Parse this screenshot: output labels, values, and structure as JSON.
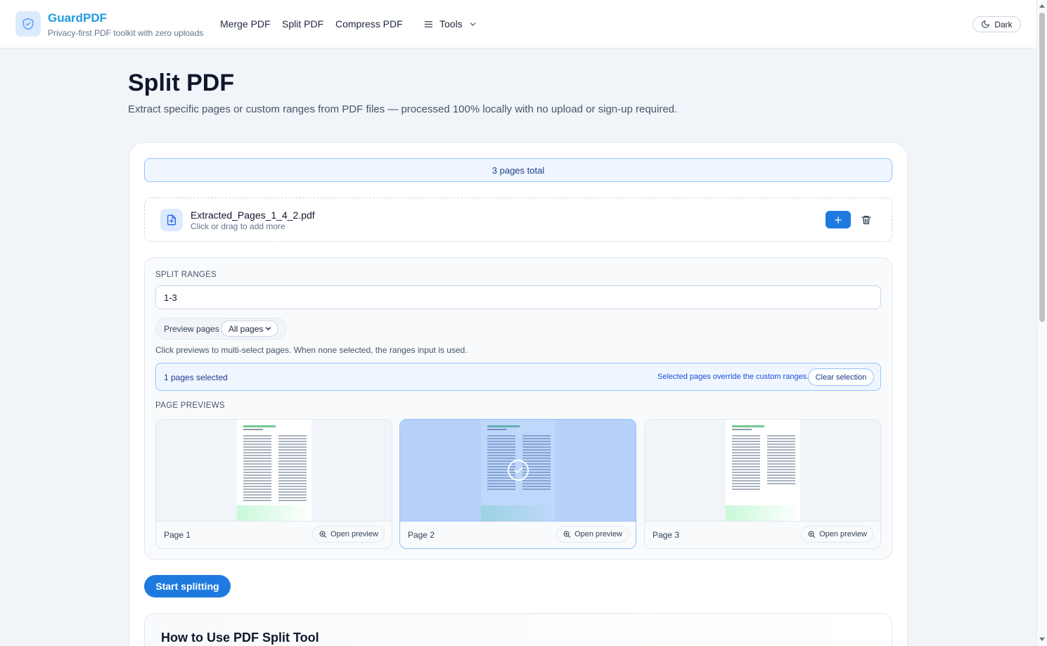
{
  "header": {
    "brand": "GuardPDF",
    "tagline": "Privacy-first PDF toolkit with zero uploads",
    "nav": [
      "Merge PDF",
      "Split PDF",
      "Compress PDF"
    ],
    "tools_label": "Tools",
    "theme_toggle": "Dark"
  },
  "page": {
    "title": "Split PDF",
    "description": "Extract specific pages or custom ranges from PDF files — processed 100% locally with no upload or sign-up required."
  },
  "summary": {
    "total_pages": "3 pages total"
  },
  "file": {
    "name": "Extracted_Pages_1_4_2.pdf",
    "hint": "Click or drag to add more"
  },
  "split": {
    "section_label": "SPLIT RANGES",
    "ranges_value": "1-3",
    "preview_label": "Preview pages",
    "preview_option": "All pages",
    "hint": "Click previews to multi-select pages. When none selected, the ranges input is used.",
    "selected_count": "1 pages selected",
    "override_note": "Selected pages override the custom ranges.",
    "clear_label": "Clear selection",
    "previews_label": "PAGE PREVIEWS"
  },
  "pages": [
    {
      "label": "Page 1",
      "open": "Open preview",
      "selected": false
    },
    {
      "label": "Page 2",
      "open": "Open preview",
      "selected": true
    },
    {
      "label": "Page 3",
      "open": "Open preview",
      "selected": false
    }
  ],
  "actions": {
    "start": "Start splitting"
  },
  "howto": {
    "title": "How to Use PDF Split Tool"
  },
  "colors": {
    "accent": "#1f7ae0",
    "brand": "#1f9be0",
    "selection": "#bfdbfe"
  }
}
